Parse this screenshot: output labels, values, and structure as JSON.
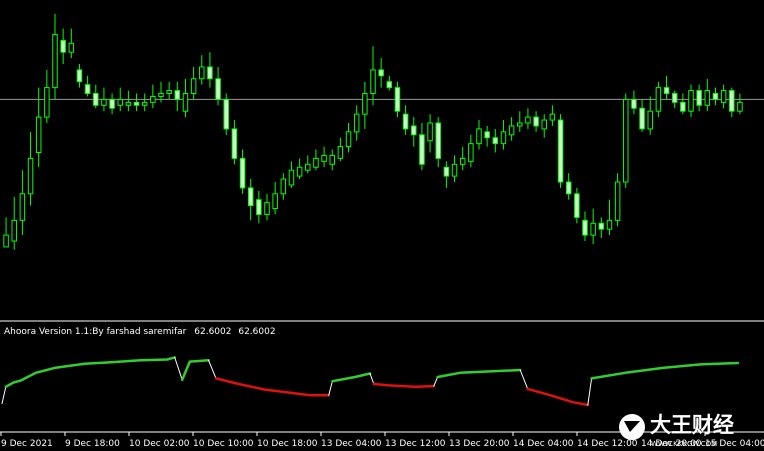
{
  "indicator": {
    "name": "Ahoora Version 1.1:By farshad saremifar",
    "value1": "62.6002",
    "value2": "62.6002"
  },
  "watermark": {
    "text": "大王财经",
    "url": "WWW.KKKGW.COM"
  },
  "colors": {
    "background": "#000000",
    "candle": "#00ff00",
    "bull_body": "#000000",
    "bear_body": "#ccffcc",
    "hline": "#9a9a9a",
    "separator": "#ffffff",
    "indicator_up": "#33cc33",
    "indicator_down": "#dd1111",
    "indicator_neutral": "#ffffff"
  },
  "chart_data": [
    {
      "type": "candlestick",
      "x_tick_labels": [
        "9 Dec 2021",
        "9 Dec 18:00",
        "10 Dec 02:00",
        "10 Dec 10:00",
        "10 Dec 18:00",
        "13 Dec 04:00",
        "13 Dec 12:00",
        "13 Dec 20:00",
        "14 Dec 04:00",
        "14 Dec 12:00",
        "14 Dec 20:00",
        "15 Dec 04:00"
      ],
      "ylim": [
        0,
        100
      ],
      "hline": 68,
      "bars": [
        [
          18,
          22,
          28,
          20
        ],
        [
          20,
          27,
          35,
          17
        ],
        [
          27,
          36,
          44,
          22
        ],
        [
          36,
          48,
          57,
          32
        ],
        [
          50,
          62,
          72,
          45
        ],
        [
          62,
          72,
          78,
          60
        ],
        [
          72,
          90,
          97,
          68
        ],
        [
          88,
          84,
          92,
          80
        ],
        [
          84,
          87,
          92,
          82
        ],
        [
          78,
          74,
          80,
          72
        ],
        [
          73,
          70,
          76,
          69
        ],
        [
          70,
          66,
          73,
          65
        ],
        [
          66,
          68,
          72,
          64
        ],
        [
          68,
          65,
          70,
          63
        ],
        [
          66,
          68,
          72,
          64
        ],
        [
          66,
          67,
          71,
          64
        ],
        [
          67,
          66,
          70,
          64
        ],
        [
          66,
          67,
          70,
          64
        ],
        [
          67,
          69,
          73,
          65
        ],
        [
          69,
          70,
          74,
          67
        ],
        [
          70,
          71,
          74,
          68
        ],
        [
          71,
          68,
          74,
          64
        ],
        [
          64,
          70,
          75,
          62
        ],
        [
          70,
          75,
          79,
          68
        ],
        [
          75,
          79,
          83,
          73
        ],
        [
          79,
          75,
          84,
          72
        ],
        [
          75,
          68,
          79,
          66
        ],
        [
          68,
          58,
          70,
          56
        ],
        [
          58,
          48,
          61,
          46
        ],
        [
          48,
          38,
          51,
          36
        ],
        [
          38,
          32,
          41,
          27
        ],
        [
          34,
          29,
          37,
          26
        ],
        [
          29,
          33,
          36,
          27
        ],
        [
          31,
          36,
          40,
          29
        ],
        [
          36,
          41,
          43,
          34
        ],
        [
          39,
          44,
          47,
          38
        ],
        [
          42,
          45,
          48,
          41
        ],
        [
          44,
          46,
          49,
          43
        ],
        [
          45,
          48,
          51,
          44
        ],
        [
          47,
          49,
          52,
          45
        ],
        [
          46,
          49,
          51,
          44
        ],
        [
          48,
          52,
          55,
          47
        ],
        [
          52,
          57,
          60,
          50
        ],
        [
          57,
          63,
          66,
          54
        ],
        [
          63,
          70,
          74,
          58
        ],
        [
          70,
          78,
          86,
          66
        ],
        [
          78,
          76,
          82,
          72
        ],
        [
          74,
          72,
          76,
          71
        ],
        [
          72,
          64,
          74,
          62
        ],
        [
          63,
          58,
          66,
          56
        ],
        [
          59,
          56,
          62,
          52
        ],
        [
          56,
          46,
          60,
          44
        ],
        [
          54,
          60,
          63,
          50
        ],
        [
          60,
          48,
          62,
          45
        ],
        [
          45,
          42,
          47,
          38
        ],
        [
          42,
          46,
          49,
          40
        ],
        [
          46,
          48,
          52,
          44
        ],
        [
          47,
          53,
          56,
          45
        ],
        [
          53,
          58,
          61,
          51
        ],
        [
          57,
          55,
          59,
          52
        ],
        [
          55,
          53,
          58,
          50
        ],
        [
          53,
          57,
          61,
          51
        ],
        [
          56,
          59,
          62,
          54
        ],
        [
          59,
          60,
          64,
          57
        ],
        [
          60,
          62,
          65,
          58
        ],
        [
          62,
          59,
          64,
          57
        ],
        [
          58,
          61,
          63,
          55
        ],
        [
          61,
          63,
          66,
          59
        ],
        [
          61,
          40,
          63,
          38
        ],
        [
          40,
          36,
          43,
          34
        ],
        [
          36,
          28,
          38,
          26
        ],
        [
          27,
          22,
          30,
          20
        ],
        [
          22,
          26,
          31,
          19
        ],
        [
          26,
          24,
          28,
          21
        ],
        [
          24,
          27,
          34,
          22
        ],
        [
          27,
          40,
          43,
          25
        ],
        [
          40,
          68,
          70,
          38
        ],
        [
          68,
          65,
          71,
          63
        ],
        [
          65,
          58,
          68,
          57
        ],
        [
          58,
          64,
          69,
          56
        ],
        [
          64,
          72,
          74,
          62
        ],
        [
          72,
          70,
          76,
          68
        ],
        [
          70,
          67,
          71,
          65
        ],
        [
          67,
          64,
          70,
          63
        ],
        [
          64,
          71,
          73,
          62
        ],
        [
          71,
          66,
          73,
          64
        ],
        [
          66,
          71,
          75,
          64
        ],
        [
          70,
          68,
          72,
          66
        ],
        [
          67,
          71,
          73,
          65
        ],
        [
          71,
          64,
          72,
          62
        ],
        [
          64,
          67,
          70,
          63
        ]
      ]
    },
    {
      "type": "line",
      "title": "Ahoora Version 1.1:By farshad saremifar",
      "ylim": [
        0,
        100
      ],
      "segments": [
        {
          "trend": "neutral",
          "points": [
            [
              0,
              12
            ],
            [
              1,
              36
            ]
          ]
        },
        {
          "trend": "up",
          "points": [
            [
              1,
              36
            ],
            [
              3,
              42
            ],
            [
              5,
              45
            ],
            [
              9,
              56
            ],
            [
              14,
              63
            ],
            [
              22,
              69
            ],
            [
              29,
              71
            ],
            [
              37,
              74
            ],
            [
              44,
              75
            ],
            [
              46,
              78
            ]
          ]
        },
        {
          "trend": "neutral",
          "points": [
            [
              46,
              78
            ],
            [
              48,
              46
            ]
          ]
        },
        {
          "trend": "up",
          "points": [
            [
              48,
              46
            ],
            [
              50,
              72
            ],
            [
              55,
              74
            ]
          ]
        },
        {
          "trend": "neutral",
          "points": [
            [
              55,
              74
            ],
            [
              57,
              48
            ]
          ]
        },
        {
          "trend": "down",
          "points": [
            [
              57,
              48
            ],
            [
              63,
              40
            ],
            [
              70,
              32
            ],
            [
              76,
              28
            ],
            [
              82,
              24
            ],
            [
              87,
              24
            ]
          ]
        },
        {
          "trend": "neutral",
          "points": [
            [
              87,
              24
            ],
            [
              88,
              44
            ]
          ]
        },
        {
          "trend": "up",
          "points": [
            [
              88,
              44
            ],
            [
              94,
              50
            ],
            [
              98,
              55
            ]
          ]
        },
        {
          "trend": "neutral",
          "points": [
            [
              98,
              55
            ],
            [
              99,
              40
            ]
          ]
        },
        {
          "trend": "down",
          "points": [
            [
              99,
              40
            ],
            [
              103,
              38
            ],
            [
              110,
              36
            ],
            [
              115,
              37
            ]
          ]
        },
        {
          "trend": "neutral",
          "points": [
            [
              115,
              37
            ],
            [
              116,
              50
            ]
          ]
        },
        {
          "trend": "up",
          "points": [
            [
              116,
              50
            ],
            [
              122,
              56
            ],
            [
              130,
              58
            ],
            [
              138,
              60
            ]
          ]
        },
        {
          "trend": "neutral",
          "points": [
            [
              138,
              60
            ],
            [
              140,
              33
            ]
          ]
        },
        {
          "trend": "down",
          "points": [
            [
              140,
              33
            ],
            [
              146,
              24
            ],
            [
              152,
              14
            ],
            [
              156,
              10
            ]
          ]
        },
        {
          "trend": "neutral",
          "points": [
            [
              156,
              10
            ],
            [
              157,
              48
            ]
          ]
        },
        {
          "trend": "up",
          "points": [
            [
              157,
              48
            ],
            [
              166,
              56
            ],
            [
              176,
              63
            ],
            [
              186,
              68
            ],
            [
              196,
              70
            ]
          ]
        }
      ]
    }
  ]
}
